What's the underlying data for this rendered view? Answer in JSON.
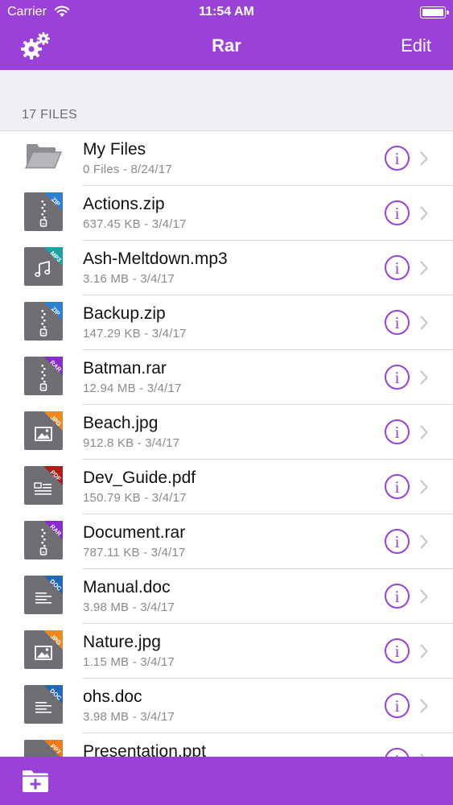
{
  "status_bar": {
    "carrier": "Carrier",
    "time": "11:54 AM"
  },
  "nav": {
    "title": "Rar",
    "edit_label": "Edit"
  },
  "section": {
    "label": "17 FILES"
  },
  "colors": {
    "accent": "#9a41d9",
    "zip": "#2d7fd3",
    "mp3": "#1aa3a3",
    "rar": "#8a2bd0",
    "jpg": "#f08a1c",
    "pdf": "#b31b1b",
    "doc": "#2466b8",
    "ppt": "#f07a1c",
    "file_body": "#6e6e73"
  },
  "files": [
    {
      "name": "My Files",
      "meta": "0 Files - 8/24/17",
      "kind": "folder",
      "icon": "folder-icon"
    },
    {
      "name": "Actions.zip",
      "meta": "637.45 KB - 3/4/17",
      "kind": "zip",
      "badge": "ZIP",
      "icon": "zip-file-icon"
    },
    {
      "name": "Ash-Meltdown.mp3",
      "meta": "3.16 MB - 3/4/17",
      "kind": "mp3",
      "badge": "MP3",
      "icon": "music-file-icon"
    },
    {
      "name": "Backup.zip",
      "meta": "147.29 KB - 3/4/17",
      "kind": "zip",
      "badge": "ZIP",
      "icon": "zip-file-icon"
    },
    {
      "name": "Batman.rar",
      "meta": "12.94 MB - 3/4/17",
      "kind": "rar",
      "badge": "RAR",
      "icon": "rar-file-icon"
    },
    {
      "name": "Beach.jpg",
      "meta": "912.8 KB - 3/4/17",
      "kind": "jpg",
      "badge": "JPG",
      "icon": "image-file-icon"
    },
    {
      "name": "Dev_Guide.pdf",
      "meta": "150.79 KB - 3/4/17",
      "kind": "pdf",
      "badge": "PDF",
      "icon": "pdf-file-icon"
    },
    {
      "name": "Document.rar",
      "meta": "787.11 KB - 3/4/17",
      "kind": "rar",
      "badge": "RAR",
      "icon": "rar-file-icon"
    },
    {
      "name": "Manual.doc",
      "meta": "3.98 MB - 3/4/17",
      "kind": "doc",
      "badge": "DOC",
      "icon": "doc-file-icon"
    },
    {
      "name": "Nature.jpg",
      "meta": "1.15 MB - 3/4/17",
      "kind": "jpg",
      "badge": "JPG",
      "icon": "image-file-icon"
    },
    {
      "name": "ohs.doc",
      "meta": "3.98 MB - 3/4/17",
      "kind": "doc",
      "badge": "DOC",
      "icon": "doc-file-icon"
    },
    {
      "name": "Presentation.ppt",
      "meta": "",
      "kind": "ppt",
      "badge": "PPT",
      "icon": "ppt-file-icon"
    }
  ],
  "bottom_bar": {
    "icon": "add-folder-icon"
  }
}
